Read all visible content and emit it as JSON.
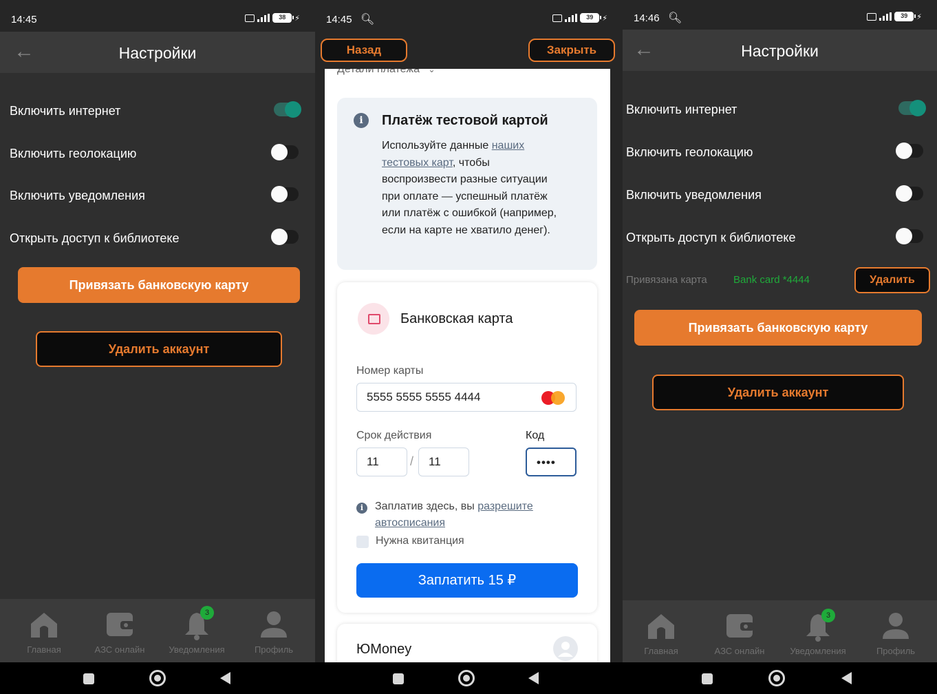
{
  "screen1": {
    "status_time": "14:45",
    "battery": "38",
    "title": "Настройки",
    "settings": [
      {
        "label": "Включить интернет",
        "on": true
      },
      {
        "label": "Включить геолокацию",
        "on": false
      },
      {
        "label": "Включить уведомления",
        "on": false
      },
      {
        "label": "Открыть доступ к библиотеке",
        "on": false
      }
    ],
    "bind_card_button": "Привязать банковскую карту",
    "delete_account_button": "Удалить аккаунт"
  },
  "screen2": {
    "status_time": "14:45",
    "battery": "39",
    "back_button": "Назад",
    "close_button": "Закрыть",
    "payment_details": "Детали платежа",
    "info_title": "Платёж тестовой картой",
    "info_text_1": "Используйте данные ",
    "info_link": "наших тестовых карт",
    "info_text_2": ", чтобы воспроизвести разные ситуации при оплате — успешный платёж или платёж с ошибкой (например, если на карте не хватило денег).",
    "card_title": "Банковская карта",
    "card_number_label": "Номер карты",
    "card_number": "5555 5555 5555 4444",
    "expiry_label": "Срок действия",
    "expiry_month": "11",
    "expiry_year": "11",
    "code_label": "Код",
    "code_value": "••••",
    "autopay_text": "Заплатив здесь, вы ",
    "autopay_link": "разрешите автосписания",
    "receipt_label": "Нужна квитанция",
    "pay_button": "Заплатить 15 ₽",
    "yoomoney_label": "ЮMoney"
  },
  "screen3": {
    "status_time": "14:46",
    "battery": "39",
    "title": "Настройки",
    "settings": [
      {
        "label": "Включить интернет",
        "on": true
      },
      {
        "label": "Включить геолокацию",
        "on": false
      },
      {
        "label": "Включить уведомления",
        "on": false
      },
      {
        "label": "Открыть доступ к библиотеке",
        "on": false
      }
    ],
    "linked_card_label": "Привязана карта",
    "linked_card_value": "Bank card *4444",
    "remove_card_button": "Удалить",
    "bind_card_button": "Привязать банковскую карту",
    "delete_account_button": "Удалить аккаунт"
  },
  "bottom_nav": [
    {
      "label": "Главная",
      "icon": "home-icon"
    },
    {
      "label": "АЗС онлайн",
      "icon": "wallet-icon"
    },
    {
      "label": "Уведомления",
      "icon": "bell-icon",
      "badge": "3"
    },
    {
      "label": "Профиль",
      "icon": "profile-icon"
    }
  ],
  "colors": {
    "accent": "#e67a2e",
    "background": "#2f2f2f",
    "toggle_on": "#14907b",
    "pay_button": "#0a6cf0",
    "linked_card": "#1faa3a"
  }
}
